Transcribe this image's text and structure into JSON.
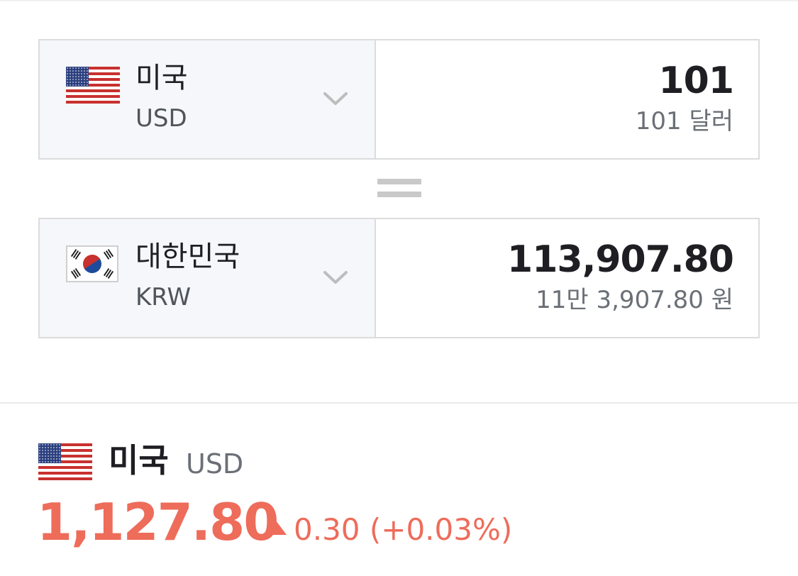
{
  "converter": {
    "from": {
      "country": "미국",
      "code": "USD",
      "flag_icon": "us-flag-icon",
      "amount": "101",
      "amount_text": "101 달러"
    },
    "to": {
      "country": "대한민국",
      "code": "KRW",
      "flag_icon": "kr-flag-icon",
      "amount": "113,907.80",
      "amount_text": "11만 3,907.80 원"
    }
  },
  "rate": {
    "country": "미국",
    "code": "USD",
    "value": "1,127.80",
    "change": "0.30 (+0.03%)",
    "direction": "up",
    "color": "#ee6c5a"
  },
  "colors": {
    "panel_bg": "#f5f7fa",
    "border": "#dcdcdc",
    "text": "#1e1e23"
  }
}
